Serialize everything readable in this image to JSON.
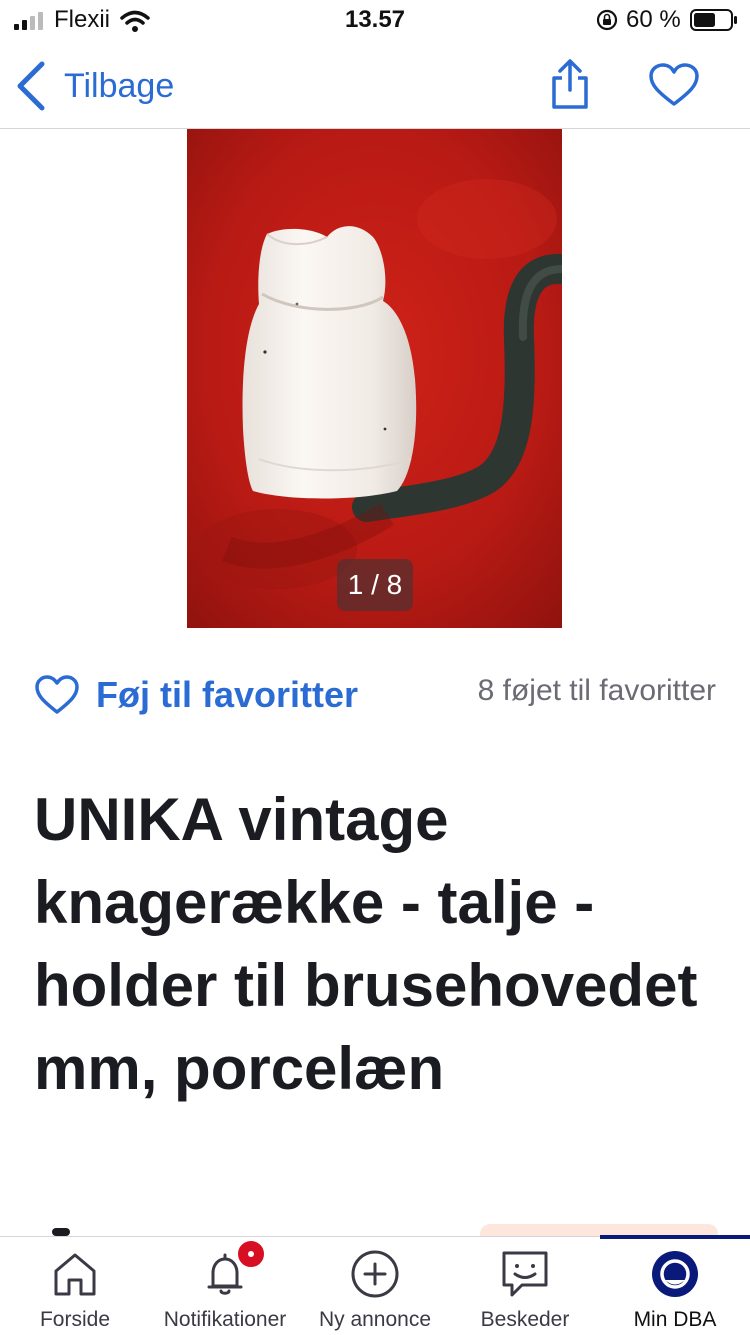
{
  "status_bar": {
    "carrier": "Flexii",
    "time": "13.57",
    "battery_percent": "60 %",
    "battery_level": 0.6
  },
  "nav": {
    "back_label": "Tilbage",
    "icons": [
      "chevron-left-icon",
      "share-icon",
      "heart-outline-icon"
    ]
  },
  "gallery": {
    "counter": "1 / 8"
  },
  "favorites": {
    "button_label": "Føj til favoritter",
    "count_text": "8 føjet til favoritter"
  },
  "listing": {
    "title": "UNIKA vintage knagerække - talje - holder til brusehovedet mm, porcelæn"
  },
  "tabbar": {
    "tabs": [
      {
        "label": "Forside",
        "icon": "home-icon"
      },
      {
        "label": "Notifikationer",
        "icon": "bell-icon"
      },
      {
        "label": "Ny annonce",
        "icon": "plus-circle-icon"
      },
      {
        "label": "Beskeder",
        "icon": "chat-icon"
      },
      {
        "label": "Min DBA",
        "icon": "profile-icon"
      }
    ],
    "active_index": 4
  },
  "colors": {
    "accent": "#2a6bd4",
    "title_text": "#1b1b22",
    "muted_text": "#6b6b73",
    "notification_dot": "#d80f23",
    "active_tab": "#0a1a7a",
    "photo_background": "#b81a14"
  }
}
